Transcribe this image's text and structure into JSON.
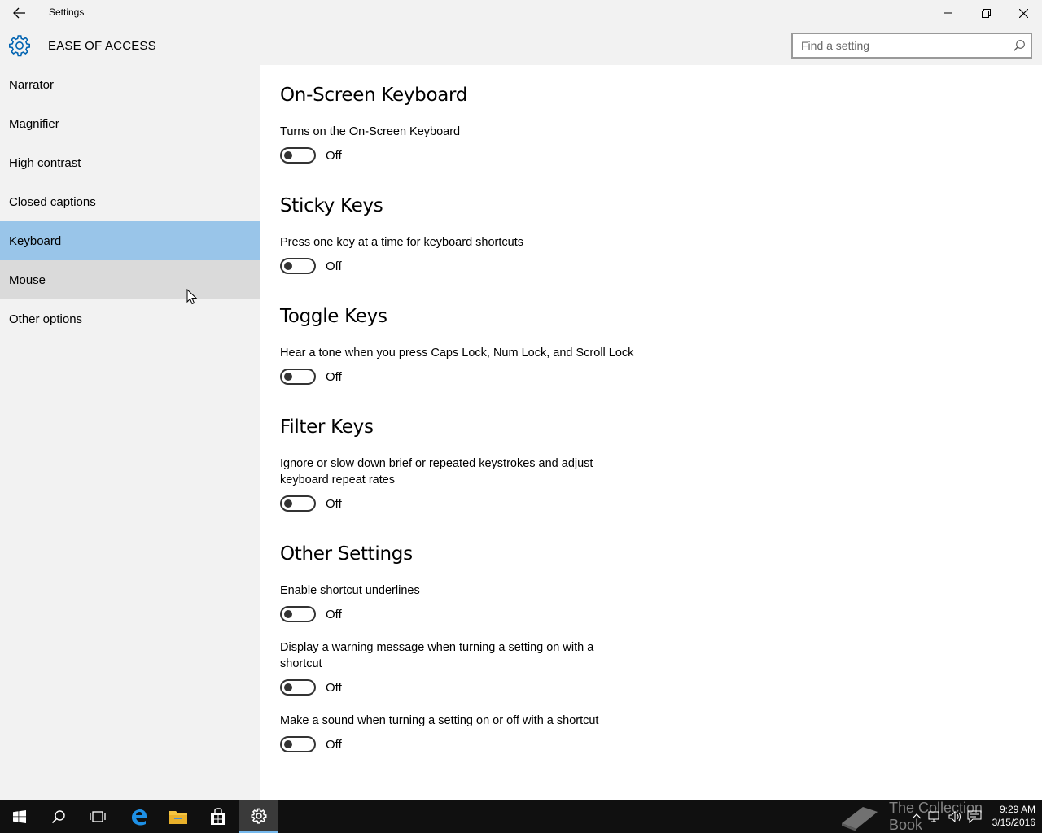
{
  "window": {
    "title": "Settings",
    "controls": [
      "minimize",
      "restore",
      "close"
    ]
  },
  "header": {
    "section": "EASE OF ACCESS",
    "search_placeholder": "Find a setting"
  },
  "sidebar": {
    "items": [
      {
        "label": "Narrator",
        "state": "normal"
      },
      {
        "label": "Magnifier",
        "state": "normal"
      },
      {
        "label": "High contrast",
        "state": "normal"
      },
      {
        "label": "Closed captions",
        "state": "normal"
      },
      {
        "label": "Keyboard",
        "state": "selected"
      },
      {
        "label": "Mouse",
        "state": "hover"
      },
      {
        "label": "Other options",
        "state": "normal"
      }
    ]
  },
  "main": {
    "sections": [
      {
        "heading": "On-Screen Keyboard",
        "settings": [
          {
            "description": "Turns on the On-Screen Keyboard",
            "state": "Off"
          }
        ]
      },
      {
        "heading": "Sticky Keys",
        "settings": [
          {
            "description": "Press one key at a time for keyboard shortcuts",
            "state": "Off"
          }
        ]
      },
      {
        "heading": "Toggle Keys",
        "settings": [
          {
            "description": "Hear a tone when you press Caps Lock, Num Lock, and Scroll Lock",
            "state": "Off"
          }
        ]
      },
      {
        "heading": "Filter Keys",
        "settings": [
          {
            "description": "Ignore or slow down brief or repeated keystrokes and adjust keyboard repeat rates",
            "state": "Off"
          }
        ]
      },
      {
        "heading": "Other Settings",
        "settings": [
          {
            "description": "Enable shortcut underlines",
            "state": "Off"
          },
          {
            "description": "Display a warning message when turning a setting on with a shortcut",
            "state": "Off"
          },
          {
            "description": "Make a sound when turning a setting on or off with a shortcut",
            "state": "Off"
          }
        ]
      }
    ]
  },
  "taskbar": {
    "apps": [
      "start",
      "search",
      "task-view",
      "edge",
      "file-explorer",
      "store",
      "settings"
    ],
    "active_app": "settings",
    "watermark": "The Collection Book",
    "clock": {
      "time": "9:29 AM",
      "date": "3/15/2016"
    }
  },
  "colors": {
    "selected_nav": "#99c5e9",
    "hover_nav": "#dadada",
    "accent": "#0063b1",
    "taskbar": "#101010"
  }
}
